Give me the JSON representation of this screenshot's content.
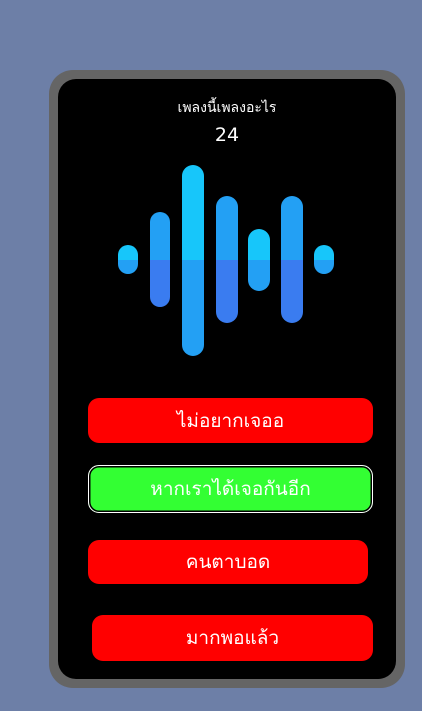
{
  "quiz": {
    "title": "เพลงนี้เพลงอะไร",
    "countdown": "24"
  },
  "waveform": {
    "colors": {
      "top": "#17c6fa",
      "middle": "#23a0f4",
      "bottom": "#3a7cf0"
    }
  },
  "answers": [
    {
      "label": "ไม่อยากเจออ",
      "state": "default",
      "color": "#ff0000"
    },
    {
      "label": "หากเราได้เจอกันอีก",
      "state": "selected",
      "color": "#33ff33"
    },
    {
      "label": "คนตาบอด",
      "state": "default",
      "color": "#ff0000"
    },
    {
      "label": "มากพอแล้ว",
      "state": "default",
      "color": "#ff0000"
    }
  ]
}
